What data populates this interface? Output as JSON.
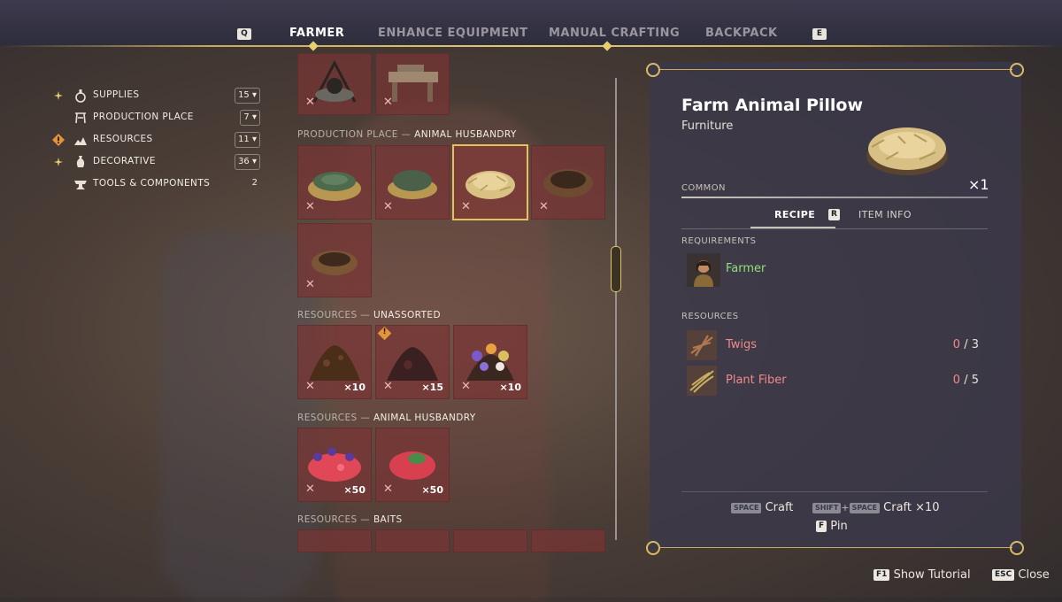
{
  "topbar": {
    "left_key": "Q",
    "right_key": "E",
    "tabs": [
      {
        "label": "FARMER",
        "active": true
      },
      {
        "label": "ENHANCE EQUIPMENT",
        "active": false
      },
      {
        "label": "MANUAL CRAFTING",
        "active": false
      },
      {
        "label": "BACKPACK",
        "active": false
      }
    ]
  },
  "categories": [
    {
      "label": "SUPPLIES",
      "count": "15",
      "marker": "sparkle",
      "icon": "flask-icon"
    },
    {
      "label": "PRODUCTION PLACE",
      "count": "7",
      "marker": "",
      "icon": "workbench-icon"
    },
    {
      "label": "RESOURCES",
      "count": "11",
      "marker": "warning",
      "icon": "ore-pile-icon"
    },
    {
      "label": "DECORATIVE",
      "count": "36",
      "marker": "sparkle",
      "icon": "vase-icon"
    },
    {
      "label": "TOOLS & COMPONENTS",
      "count": "2",
      "marker": "",
      "icon": "anvil-icon"
    }
  ],
  "sections": [
    {
      "category": "PRODUCTION PLACE",
      "sub": "ANIMAL HUSBANDRY"
    },
    {
      "category": "RESOURCES",
      "sub": "UNASSORTED"
    },
    {
      "category": "RESOURCES",
      "sub": "ANIMAL HUSBANDRY"
    },
    {
      "category": "RESOURCES",
      "sub": "BAITS"
    }
  ],
  "slot_marks": {
    "missing": "✕",
    "warning": "!"
  },
  "quantities": {
    "unassorted": [
      "×10",
      "×15",
      "×10"
    ],
    "animal_husbandry": [
      "×50",
      "×50"
    ]
  },
  "item": {
    "name": "Farm Animal Pillow",
    "type": "Furniture",
    "rarity": "COMMON",
    "quantity": "×1",
    "tabs": {
      "recipe": "RECIPE",
      "key": "R",
      "info": "ITEM INFO"
    },
    "requirements_label": "REQUIREMENTS",
    "requirement": "Farmer",
    "resources_label": "RESOURCES",
    "resources": [
      {
        "name": "Twigs",
        "have": "0",
        "need": "/ 3"
      },
      {
        "name": "Plant Fiber",
        "have": "0",
        "need": "/ 5"
      }
    ]
  },
  "actions": {
    "craft_key": "SPACE",
    "craft": "Craft",
    "shift_key": "SHIFT",
    "plus": "+",
    "space_key": "SPACE",
    "craft10": "Craft ×10",
    "pin_key": "F",
    "pin": "Pin"
  },
  "footer": {
    "tutorial_key": "F1",
    "tutorial": "Show Tutorial",
    "close_key": "ESC",
    "close": "Close"
  },
  "colors": {
    "accent": "#e3c25d",
    "missing": "#f08a8a",
    "requirement_ok": "#8fe07a",
    "slot_bg": "#783434"
  }
}
